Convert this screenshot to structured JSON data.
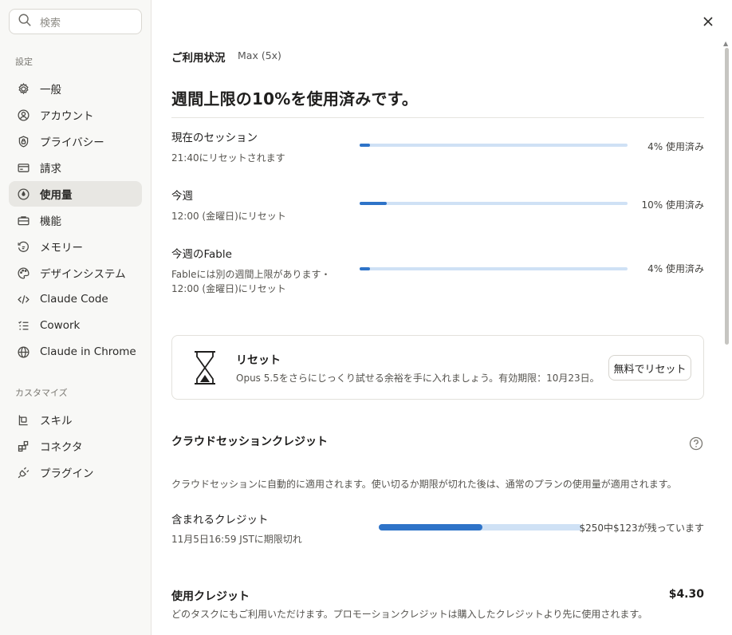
{
  "sidebar": {
    "search_placeholder": "検索",
    "settings_label": "設定",
    "items": [
      {
        "label": "一般",
        "icon": "gear-icon"
      },
      {
        "label": "アカウント",
        "icon": "user-circle-icon"
      },
      {
        "label": "プライバシー",
        "icon": "shield-lock-icon"
      },
      {
        "label": "請求",
        "icon": "credit-card-icon"
      },
      {
        "label": "使用量",
        "icon": "gauge-icon",
        "active": true
      },
      {
        "label": "機能",
        "icon": "briefcase-icon"
      },
      {
        "label": "メモリー",
        "icon": "memory-icon"
      },
      {
        "label": "デザインシステム",
        "icon": "palette-icon"
      },
      {
        "label": "Claude Code",
        "icon": "code-icon"
      },
      {
        "label": "Cowork",
        "icon": "checklist-icon"
      },
      {
        "label": "Claude in Chrome",
        "icon": "globe-icon"
      }
    ],
    "customize_label": "カスタマイズ",
    "customize_items": [
      {
        "label": "スキル",
        "icon": "skill-icon"
      },
      {
        "label": "コネクタ",
        "icon": "connector-icon"
      },
      {
        "label": "プラグイン",
        "icon": "plug-icon"
      }
    ]
  },
  "main": {
    "plan_title": "ご利用状況",
    "plan_badge": "Max (5x)",
    "headline": "週間上限の10%を使用済みです。",
    "usage": [
      {
        "label": "現在のセッション",
        "sub": [
          "21:40にリセットされます"
        ],
        "percent": 4,
        "status": "4% 使用済み"
      },
      {
        "label": "今週",
        "sub": [
          "12:00 (金曜日)にリセット"
        ],
        "percent": 10,
        "status": "10% 使用済み"
      },
      {
        "label": "今週のFable",
        "sub": [
          "Fableには別の週間上限があります・",
          "12:00 (金曜日)にリセット"
        ],
        "percent": 4,
        "status": "4% 使用済み"
      }
    ],
    "reset_card": {
      "title": "リセット",
      "desc": "Opus 5.5をさらにじっくり試せる余裕を手に入れましょう。有効期限：10月23日。",
      "button": "無料でリセット"
    },
    "cloud": {
      "title": "クラウドセッションクレジット",
      "desc": "クラウドセッションに自動的に適用されます。使い切るか期限が切れた後は、通常のプランの使用量が適用されます。",
      "credit_label": "含まれるクレジット",
      "credit_sub": "11月5日16:59 JSTに期限切れ",
      "credit_fraction": 0.508,
      "credit_remaining": "$250中$123が残っています"
    },
    "used_credit": {
      "title": "使用クレジット",
      "amount": "$4.30",
      "desc": "どのタスクにもご利用いただけます。プロモーションクレジットは購入したクレジットより先に使用されます。"
    }
  },
  "colors": {
    "accent": "#2e73c8",
    "bar_track": "#cfe1f5",
    "sidebar_bg": "#f8f8f6",
    "active_bg": "#e8e7e3"
  }
}
